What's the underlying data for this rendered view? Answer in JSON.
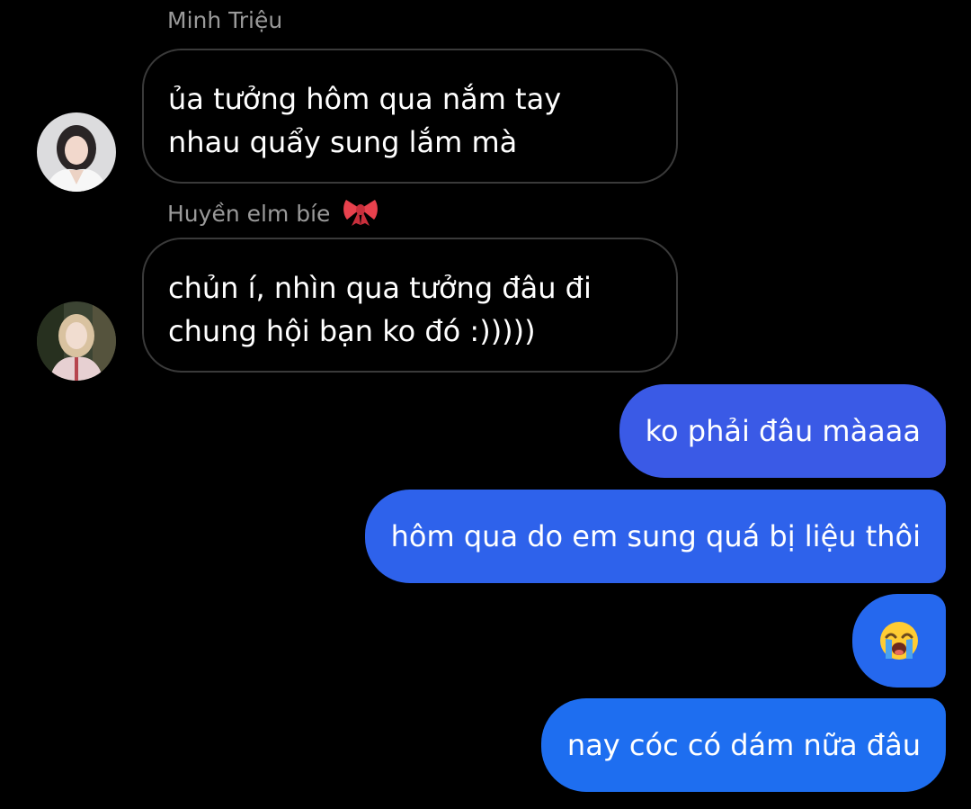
{
  "colors": {
    "background": "#000000",
    "incoming_bubble_border": "#3a3a3a",
    "sender_name": "#9a9a9a",
    "outgoing_bubble_top": "#3a5ae6",
    "outgoing_bubble_bottom": "#1e6ef0"
  },
  "messages": [
    {
      "direction": "incoming",
      "sender": "Minh Triệu",
      "avatar_icon": "profile-photo-woman-white-outfit",
      "lines": [
        "ủa tưởng hôm qua nắm tay",
        "nhau quẩy sung lắm mà"
      ]
    },
    {
      "direction": "incoming",
      "sender": "Huyền elm bíe",
      "sender_emoji_icon": "ribbon-bow-icon",
      "avatar_icon": "profile-photo-woman-pink-dress",
      "lines": [
        "chủn í, nhìn qua tưởng đâu đi",
        "chung hội bạn ko đó :)))))"
      ]
    },
    {
      "direction": "outgoing",
      "text": "ko phải đâu màaaa"
    },
    {
      "direction": "outgoing",
      "text": "hôm qua do em sung quá bị liệu thôi"
    },
    {
      "direction": "outgoing",
      "emoji_icon": "loudly-crying-face-icon"
    },
    {
      "direction": "outgoing",
      "text": "nay cóc có dám nữa đâu"
    }
  ]
}
